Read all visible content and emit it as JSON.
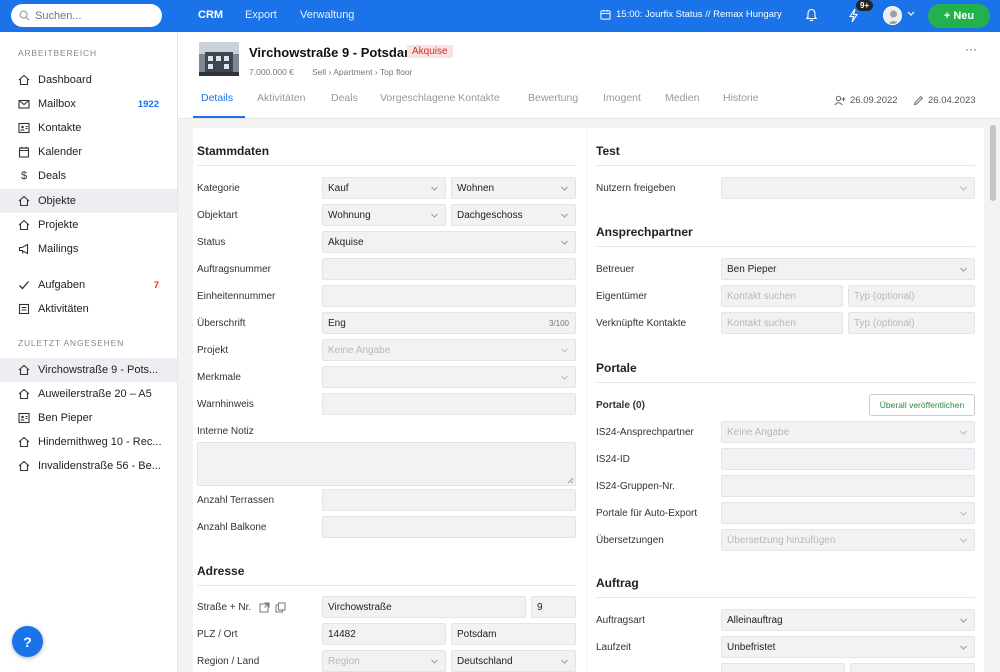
{
  "topbar": {
    "search_placeholder": "Suchen...",
    "nav": [
      "CRM",
      "Export",
      "Verwaltung"
    ],
    "event": "15:00: Jourfix Status // Remax Hungary",
    "notif_badge": "9+",
    "new_button": "+ Neu"
  },
  "sidebar": {
    "workspace_heading": "ARBEITBEREICH",
    "items": [
      {
        "label": "Dashboard",
        "icon": "home-icon"
      },
      {
        "label": "Mailbox",
        "icon": "mail-icon",
        "count": "1922"
      },
      {
        "label": "Kontakte",
        "icon": "contact-card-icon"
      },
      {
        "label": "Kalender",
        "icon": "calendar-icon"
      },
      {
        "label": "Deals",
        "icon": "dollar-icon"
      },
      {
        "label": "Objekte",
        "icon": "house-icon",
        "active": true
      },
      {
        "label": "Projekte",
        "icon": "buildings-icon"
      },
      {
        "label": "Mailings",
        "icon": "megaphone-icon"
      }
    ],
    "tasks": [
      {
        "label": "Aufgaben",
        "icon": "check-icon",
        "count": "7"
      },
      {
        "label": "Aktivitäten",
        "icon": "list-icon"
      }
    ],
    "recent_heading": "ZULETZT ANGESEHEN",
    "recent": [
      {
        "label": "Virchowstraße 9 - Pots...",
        "icon": "house-icon"
      },
      {
        "label": "Auweilerstraße 20 – A5",
        "icon": "house-icon"
      },
      {
        "label": "Ben Pieper",
        "icon": "contact-card-icon"
      },
      {
        "label": "Hindemithweg 10 - Rec...",
        "icon": "house-icon"
      },
      {
        "label": "Invalidenstraße 56 - Be...",
        "icon": "house-icon"
      }
    ],
    "help": "?"
  },
  "header": {
    "title": "Virchowstraße 9 - Potsdam",
    "status": "Akquise",
    "price": "7.000.000 €",
    "breadcrumb": "Sell › Apartment › Top floor",
    "more": "···"
  },
  "tabs": [
    "Details",
    "Aktivitäten",
    "Deals",
    "Vorgeschlagene Kontakte",
    "Bewertung",
    "Imogent",
    "Medien",
    "Historie"
  ],
  "meta": {
    "created": "26.09.2022",
    "edited": "26.04.2023"
  },
  "stammdaten": {
    "title": "Stammdaten",
    "kategorie": {
      "label": "Kategorie",
      "v1": "Kauf",
      "v2": "Wohnen"
    },
    "objektart": {
      "label": "Objektart",
      "v1": "Wohnung",
      "v2": "Dachgeschoss"
    },
    "status": {
      "label": "Status",
      "value": "Akquise"
    },
    "auftragsnummer": {
      "label": "Auftragsnummer",
      "value": ""
    },
    "einheitennummer": {
      "label": "Einheitennummer",
      "value": ""
    },
    "ueberschrift": {
      "label": "Überschrift",
      "value": "Eng",
      "counter": "3/100"
    },
    "projekt": {
      "label": "Projekt",
      "placeholder": "Keine Angabe"
    },
    "merkmale": {
      "label": "Merkmale",
      "value": ""
    },
    "warnhinweis": {
      "label": "Warnhinweis",
      "value": ""
    },
    "interne_notiz": {
      "label": "Interne Notiz",
      "value": ""
    },
    "terrassen": {
      "label": "Anzahl Terrassen",
      "value": ""
    },
    "balkone": {
      "label": "Anzahl Balkone",
      "value": ""
    }
  },
  "adresse": {
    "title": "Adresse",
    "strasse": {
      "label": "Straße + Nr.",
      "street": "Virchowstraße",
      "number": "9"
    },
    "plz": {
      "label": "PLZ / Ort",
      "plz": "14482",
      "ort": "Potsdam"
    },
    "region": {
      "label": "Region / Land",
      "region_placeholder": "Region",
      "land": "Deutschland"
    }
  },
  "test": {
    "title": "Test",
    "nutzern": {
      "label": "Nutzern freigeben",
      "value": ""
    }
  },
  "ansprechpartner": {
    "title": "Ansprechpartner",
    "betreuer": {
      "label": "Betreuer",
      "value": "Ben Pieper"
    },
    "eigentuemer": {
      "label": "Eigentümer",
      "contact_ph": "Kontakt suchen",
      "type_ph": "Typ (optional)"
    },
    "verknuepft": {
      "label": "Verknüpfte Kontakte",
      "contact_ph": "Kontakt suchen",
      "type_ph": "Typ (optional)"
    }
  },
  "portale": {
    "title": "Portale",
    "count_label": "Portale (0)",
    "publish_button": "Überall veröffentlichen",
    "is24_contact": {
      "label": "IS24-Ansprechpartner",
      "placeholder": "Keine Angabe"
    },
    "is24_id": {
      "label": "IS24-ID",
      "value": ""
    },
    "is24_group": {
      "label": "IS24-Gruppen-Nr.",
      "value": ""
    },
    "auto_export": {
      "label": "Portale für Auto-Export",
      "value": ""
    },
    "translations": {
      "label": "Übersetzungen",
      "placeholder": "Übersetzung hinzufügen"
    }
  },
  "auftrag": {
    "title": "Auftrag",
    "art": {
      "label": "Auftragsart",
      "value": "Alleinauftrag"
    },
    "laufzeit": {
      "label": "Laufzeit",
      "value": "Unbefristet"
    }
  }
}
